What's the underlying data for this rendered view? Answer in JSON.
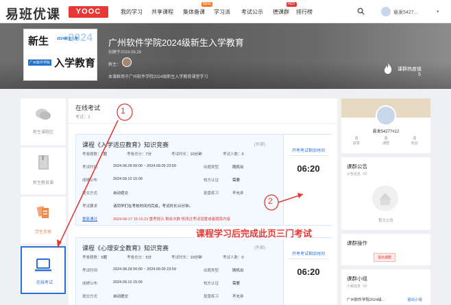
{
  "header": {
    "logo_text": "易班优课",
    "logo_badge": "YOOC",
    "nav": [
      {
        "label": "我的学习",
        "tag": ""
      },
      {
        "label": "共享课程",
        "tag": ""
      },
      {
        "label": "集体备课",
        "tag": "NEW"
      },
      {
        "label": "学习派",
        "tag": ""
      },
      {
        "label": "考试公示",
        "tag": ""
      },
      {
        "label": "德课群",
        "tag": "HOT"
      },
      {
        "label": "排行榜",
        "tag": ""
      }
    ],
    "user_name": "悬发5427..."
  },
  "banner": {
    "cover_big1": "新生",
    "cover_small": "2024新生入学",
    "cover_big2": "入学教育",
    "cover_sub": "广州软件学院",
    "cover_year": "2024",
    "title": "广州软件学院2024级新生入学教育",
    "created": "创建于2024.08.26",
    "owner_label": "群主：",
    "description": "本课群用于广州软件学院2024级新生入学教育课堂学习",
    "hot_label": "课群热度值",
    "hot_count": "5"
  },
  "sidebar": [
    {
      "label": "新生课程区",
      "icon": "chat-icon"
    },
    {
      "label": "新生教育课",
      "icon": "book-icon"
    },
    {
      "label": "学生手册",
      "icon": "file-icon"
    },
    {
      "label": "在线考试",
      "icon": "laptop-icon"
    }
  ],
  "main": {
    "title": "在线考试",
    "count": "考试：3",
    "cards": [
      {
        "title": "课程《入学适应教育》知识竞赛",
        "ext": "(外部)",
        "q_count_k": "考卷题数：",
        "q_count_v": "7题",
        "score_k": "考卷总分：",
        "score_v": "7分",
        "duration_k": "考试时长：",
        "duration_v": "10分钟",
        "takers_k": "考试人数：",
        "takers_v": "0",
        "time_k": "考试时间",
        "time_v": "2024.08.28 00:00 ~ 2024.09.09 23:59",
        "type_k": "出题类型",
        "type_v": "随机出",
        "publish_k": "成绩公布",
        "publish_v": "2024.09.10 15:09",
        "school_k": "校方认证",
        "school_v": "需要",
        "submit_k": "提交方式",
        "submit_v": "自动提交",
        "practice_k": "复盘练习",
        "practice_v": "不允许",
        "req_k": "考试要求",
        "req_v": "请同学们在考核时间内完成，考试时长10分钟。",
        "red_k": "重复通过",
        "red_v": "2024-08-27 15:15:23 重考提示 剩余次数 修改过考试设置或者题库内容",
        "box_label": "开考考试剩余时间",
        "box_time": "06:20"
      },
      {
        "title": "课程《心理安全教育》知识竞赛",
        "ext": "(外部)",
        "q_count_k": "考卷题数：",
        "q_count_v": "5题",
        "score_k": "考卷总分：",
        "score_v": "5分",
        "duration_k": "考试时长：",
        "duration_v": "10分钟",
        "takers_k": "考试人数：",
        "takers_v": "0",
        "time_k": "考试时间",
        "time_v": "2024.08.28 00:00 ~ 2024.09.09 23:59",
        "type_k": "出题类型",
        "type_v": "随机出",
        "publish_k": "成绩公布",
        "publish_v": "2024.09.10 15:09",
        "school_k": "校方认证",
        "school_v": "需要",
        "submit_k": "提交方式",
        "submit_v": "自动提交",
        "practice_k": "复盘练习",
        "practice_v": "不允许",
        "box_label": "开考考试剩余时间",
        "box_time": "06:20"
      }
    ]
  },
  "right_panel": {
    "user_name": "悬发5427?#12",
    "stats": [
      {
        "value": "0",
        "label": "获赞"
      },
      {
        "value": "0",
        "label": "课群"
      },
      {
        "value": "0",
        "label": "粉丝"
      }
    ],
    "notice_title": "课群公告",
    "notice_sub": "公告信息（0）",
    "notice_empty": "暂无公告",
    "ops_title": "课群操作",
    "ops_button": "退出课群",
    "group_title": "课群小组",
    "group_sub": "小组信息（0）",
    "group_item": "广州软件学院2024级...",
    "group_link": "退出小组"
  },
  "annotations": {
    "circle1": "1",
    "circle2": "2",
    "text": "课程学习后完成此页三门考试"
  },
  "colors": {
    "brand_red": "#e53935",
    "accent_blue": "#2b6fd6"
  }
}
